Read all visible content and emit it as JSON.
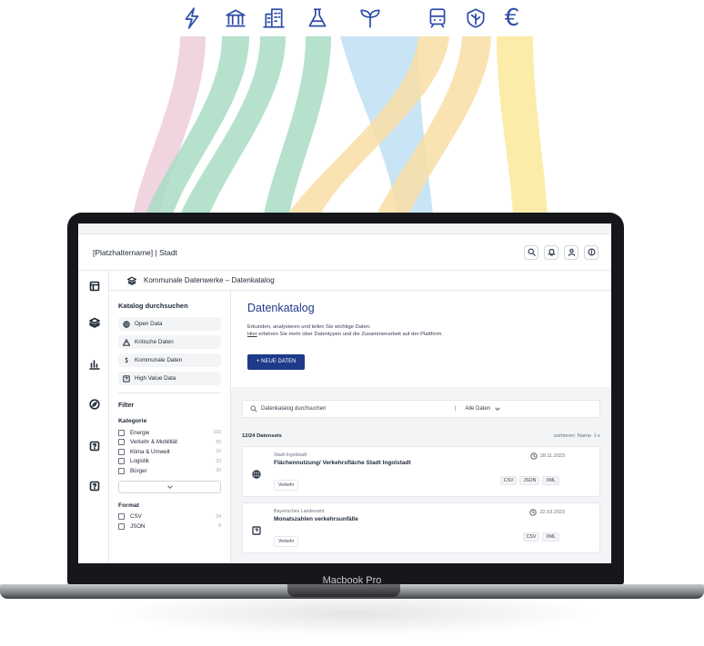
{
  "top_icons": [
    {
      "icon": "lightning-icon",
      "color": "#2f4ea8"
    },
    {
      "icon": "bank-icon",
      "color": "#2f4ea8"
    },
    {
      "icon": "buildings-icon",
      "color": "#2f4ea8"
    },
    {
      "icon": "flask-icon",
      "color": "#2f4ea8"
    },
    {
      "icon": "sprout-icon",
      "color": "#2f4ea8"
    },
    {
      "icon": "train-icon",
      "color": "#2f4ea8"
    },
    {
      "icon": "leaf-badge-icon",
      "color": "#2f4ea8"
    },
    {
      "icon": "euro-icon",
      "glyph": "€",
      "color": "#2f4ea8"
    }
  ],
  "ribbon_colors": [
    "#f0d4e0",
    "#a9dcc4",
    "#a9dcc4",
    "#a9dcc4",
    "#bfe0f3",
    "#f9dea6",
    "#f9dea6",
    "#fbeaa0"
  ],
  "device_label": "Macbook Pro",
  "app": {
    "title": "[Platzhaltername]  |  Stadt",
    "breadcrumb": "Kommunale Datenwerke – Datenkatalog"
  },
  "catalog": {
    "heading": "Katalog durchsuchen",
    "categories": [
      "Open Data",
      "Kritische Daten",
      "Kommunale Daten",
      "High Value Data"
    ]
  },
  "filter": {
    "title": "Filter",
    "kategorie_title": "Kategorie",
    "kategorie": [
      {
        "label": "Energie",
        "count": "100"
      },
      {
        "label": "Verkehr & Mobilität",
        "count": "50"
      },
      {
        "label": "Klima & Umwelt",
        "count": "10"
      },
      {
        "label": "Logistik",
        "count": "23"
      },
      {
        "label": "Bürger",
        "count": "20"
      }
    ],
    "format_title": "Format",
    "format": [
      {
        "label": "CSV",
        "count": "24"
      },
      {
        "label": "JSON",
        "count": "8"
      }
    ]
  },
  "main": {
    "title": "Datenkatalog",
    "description_1": "Erkunden, analysieren und teilen Sie wichtige Daten.",
    "description_link": "Hier",
    "description_2": " erfahren Sie mehr über Datentypen und die Zusammenarbeit auf der Plattform.",
    "new_button": "+   NEUE DATEN",
    "search_placeholder": "Datenkatalog durchsuchen",
    "search_scope": "Alle Daten",
    "count_label": "12/24 Datensets",
    "sort_label": "sortieren: Name"
  },
  "datasets": [
    {
      "org": "Stadt Ingolstadt",
      "title": "Flächennutzung/ Verkehrsfläche Stadt Ingolstadt",
      "date": "28.11.2023",
      "tag": "Verkehr",
      "formats": [
        "CSV",
        "JSON",
        "XML"
      ],
      "icon": "globe-icon"
    },
    {
      "org": "Bayerisches Landesamt",
      "title": "Monatszahlen verkehrsunfälle",
      "date": "22.03.2023",
      "tag": "Verkehr",
      "formats": [
        "CSV",
        "XML"
      ],
      "icon": "question-icon"
    }
  ]
}
